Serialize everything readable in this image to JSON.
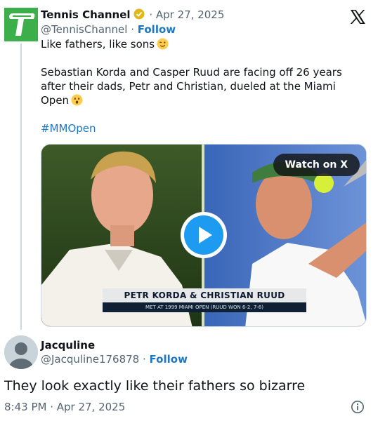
{
  "quoted_tweet": {
    "author_name": "Tennis Channel",
    "date": "Apr 27, 2025",
    "handle": "@TennisChannel",
    "follow_label": "Follow",
    "text_line1": "Like fathers, like sons",
    "text_line2": "Sebastian Korda and Casper Ruud are facing off 26 years after their dads, Petr and Christian, dueled at the Miami Open",
    "hashtag": "#MMOpen",
    "media": {
      "watch_label": "Watch on X",
      "caption_title": "PETR KORDA & CHRISTIAN RUUD",
      "caption_subtitle": "MET AT 1999 MIAMI OPEN (RUUD WON 6-2, 7-6)"
    }
  },
  "reply": {
    "author_name": "Jacquline",
    "handle": "@Jacquline176878",
    "follow_label": "Follow",
    "text": "They look exactly like their fathers so bizarre",
    "timestamp": "8:43 PM · Apr 27, 2025"
  },
  "colors": {
    "accent": "#1d9bf0",
    "brand_green": "#3cae4a",
    "muted": "#536471"
  },
  "icons": [
    "tennis-channel-logo",
    "verified-badge-icon",
    "x-logo-icon",
    "wink-emoji",
    "astonished-emoji",
    "play-icon",
    "default-avatar-icon",
    "info-icon"
  ]
}
